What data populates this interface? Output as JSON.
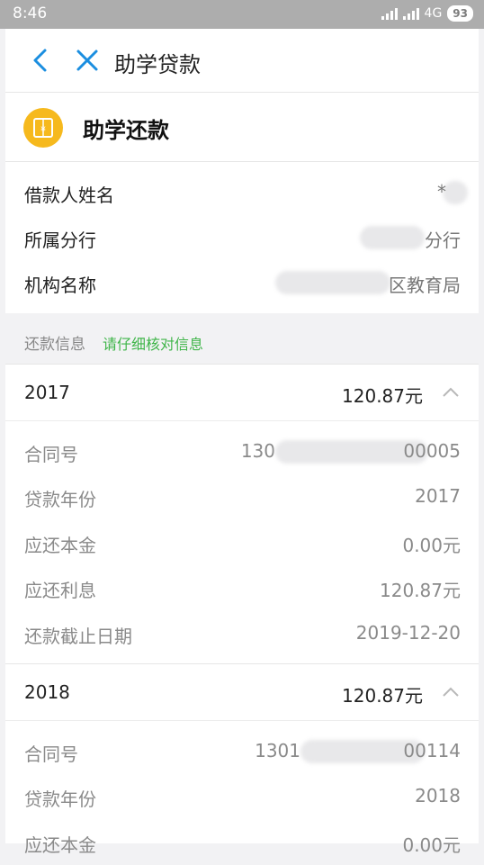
{
  "status_bar": {
    "time": "8:46",
    "network": "4G",
    "battery": "93"
  },
  "nav": {
    "title": "助学贷款"
  },
  "app": {
    "title": "助学还款"
  },
  "borrower": [
    {
      "label": "借款人姓名",
      "value": "*"
    },
    {
      "label": "所属分行",
      "value": "分行"
    },
    {
      "label": "机构名称",
      "value": "区教育局"
    }
  ],
  "repayment_header": {
    "label": "还款信息",
    "hint": "请仔细核对信息"
  },
  "years": [
    {
      "year": "2017",
      "amount": "120.87元",
      "details": [
        {
          "label": "合同号",
          "value_prefix": "130",
          "value_suffix": "00005"
        },
        {
          "label": "贷款年份",
          "value": "2017"
        },
        {
          "label": "应还本金",
          "value": "0.00元"
        },
        {
          "label": "应还利息",
          "value": "120.87元"
        },
        {
          "label": "还款截止日期",
          "value": "2019-12-20"
        }
      ]
    },
    {
      "year": "2018",
      "amount": "120.87元",
      "details": [
        {
          "label": "合同号",
          "value_prefix": "1301",
          "value_suffix": "00114"
        },
        {
          "label": "贷款年份",
          "value": "2018"
        },
        {
          "label": "应还本金",
          "value": "0.00元"
        }
      ]
    }
  ]
}
